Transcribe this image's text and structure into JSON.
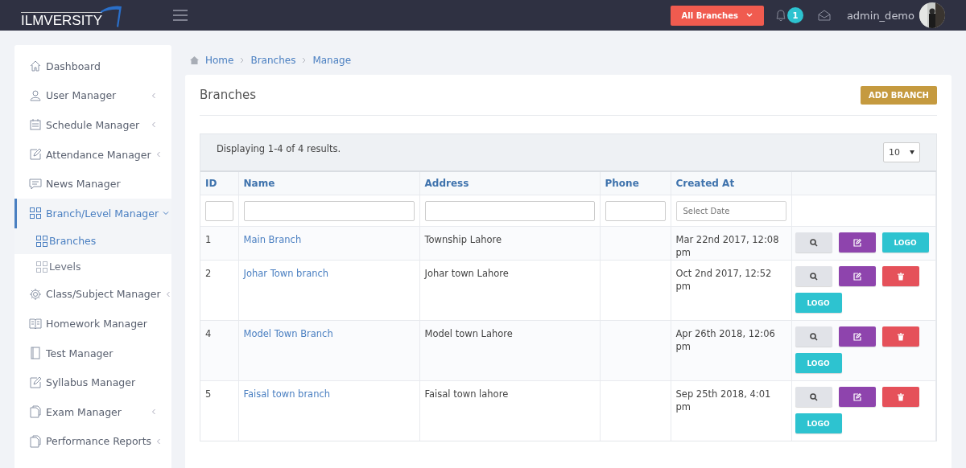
{
  "topbar": {
    "logo": "ILMVERSITY",
    "branch_selector": "All Branches",
    "notification_count": "1",
    "username": "admin_demo"
  },
  "sidebar": {
    "items": [
      {
        "label": "Dashboard",
        "selected": false
      },
      {
        "label": "User Manager",
        "selected": false,
        "expanded": false
      },
      {
        "label": "Schedule Manager",
        "selected": false,
        "expanded": false
      },
      {
        "label": "Attendance Manager",
        "selected": false,
        "expanded": false
      },
      {
        "label": "News Manager",
        "selected": false
      },
      {
        "label": "Branch/Level Manager",
        "selected": true,
        "expanded": true,
        "children": [
          {
            "label": "Branches",
            "selected": true
          },
          {
            "label": "Levels",
            "selected": false
          }
        ]
      },
      {
        "label": "Class/Subject Manager",
        "selected": false,
        "expanded": false
      },
      {
        "label": "Homework Manager",
        "selected": false
      },
      {
        "label": "Test Manager",
        "selected": false
      },
      {
        "label": "Syllabus Manager",
        "selected": false
      },
      {
        "label": "Exam Manager",
        "selected": false,
        "expanded": false
      },
      {
        "label": "Performance Reports",
        "selected": false,
        "expanded": false
      }
    ]
  },
  "breadcrumb": [
    "Home",
    "Branches",
    "Manage"
  ],
  "panel": {
    "title": "Branches",
    "add_button": "ADD BRANCH",
    "summary": "Displaying 1-4 of 4 results.",
    "page_size": "10"
  },
  "table": {
    "columns": [
      "ID",
      "Name",
      "Address",
      "Phone",
      "Created At"
    ],
    "filters": [
      {
        "kind": "text"
      },
      {
        "kind": "text"
      },
      {
        "kind": "text"
      },
      {
        "kind": "text"
      },
      {
        "kind": "date",
        "placeholder": "Select Date"
      }
    ],
    "rows": [
      {
        "id": "1",
        "name": "Main Branch",
        "address": "Township Lahore",
        "created_at": "Mar 22nd 2017, 12:08 pm",
        "actions": [
          {
            "kind": "view"
          },
          {
            "kind": "edit"
          },
          {
            "kind": "logo",
            "label": "LOGO"
          }
        ]
      },
      {
        "id": "2",
        "name": "Johar Town branch",
        "address": "Johar town Lahore",
        "created_at": "Oct 2nd 2017, 12:52 pm",
        "actions": [
          {
            "kind": "view"
          },
          {
            "kind": "edit"
          },
          {
            "kind": "delete"
          },
          {
            "kind": "logo",
            "label": "LOGO"
          }
        ]
      },
      {
        "id": "4",
        "name": "Model Town Branch",
        "address": "Model town Lahore",
        "created_at": "Apr 26th 2018, 12:06 pm",
        "actions": [
          {
            "kind": "view"
          },
          {
            "kind": "edit"
          },
          {
            "kind": "delete"
          },
          {
            "kind": "logo",
            "label": "LOGO"
          }
        ]
      },
      {
        "id": "5",
        "name": "Faisal town branch",
        "address": "Faisal town lahore",
        "created_at": "Sep 25th 2018, 4:01 pm",
        "actions": [
          {
            "kind": "view"
          },
          {
            "kind": "edit"
          },
          {
            "kind": "delete"
          },
          {
            "kind": "logo",
            "label": "LOGO"
          }
        ]
      }
    ]
  }
}
